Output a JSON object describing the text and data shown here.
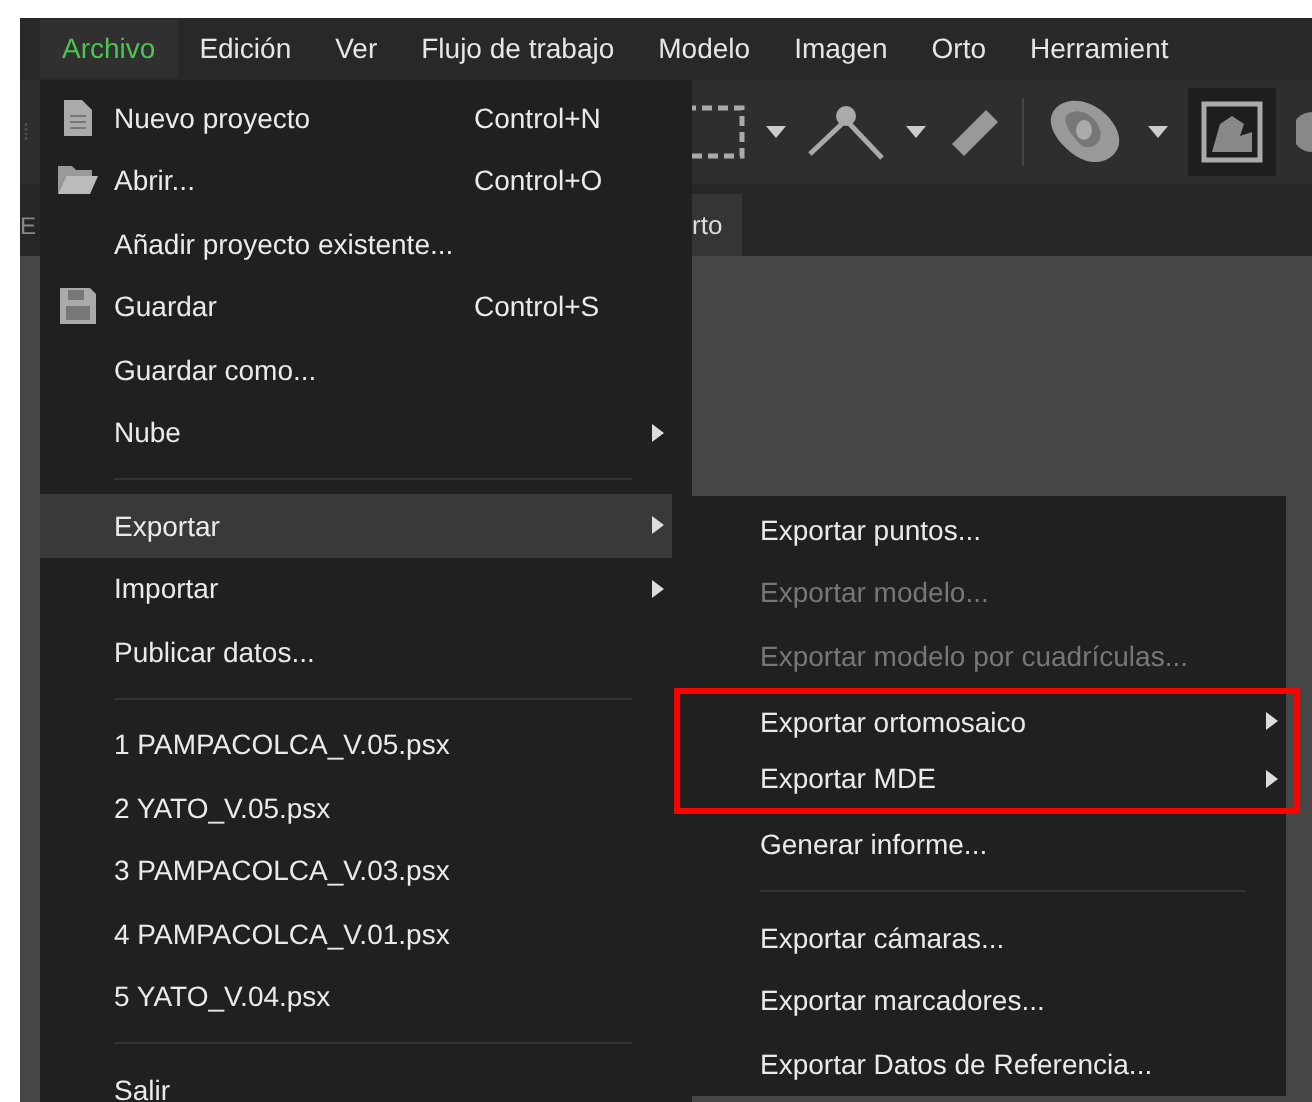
{
  "menubar": [
    {
      "label": "Archivo",
      "selected": true
    },
    {
      "label": "Edición",
      "selected": false
    },
    {
      "label": "Ver",
      "selected": false
    },
    {
      "label": "Flujo de trabajo",
      "selected": false
    },
    {
      "label": "Modelo",
      "selected": false
    },
    {
      "label": "Imagen",
      "selected": false
    },
    {
      "label": "Orto",
      "selected": false
    },
    {
      "label": "Herramient",
      "selected": false
    }
  ],
  "side_strip": {
    "label": "E"
  },
  "tabs": [
    {
      "label": "rto"
    }
  ],
  "file_menu": [
    {
      "kind": "item",
      "label": "Nuevo proyecto",
      "shortcut": "Control+N",
      "submenu": false,
      "selected": false
    },
    {
      "kind": "item",
      "label": "Abrir...",
      "shortcut": "Control+O",
      "submenu": false,
      "selected": false
    },
    {
      "kind": "item",
      "label": "Añadir proyecto existente...",
      "submenu": false,
      "selected": false
    },
    {
      "kind": "item",
      "label": "Guardar",
      "shortcut": "Control+S",
      "submenu": false,
      "selected": false
    },
    {
      "kind": "item",
      "label": "Guardar como...",
      "submenu": false,
      "selected": false
    },
    {
      "kind": "item",
      "label": "Nube",
      "submenu": true,
      "selected": false
    },
    {
      "kind": "separator"
    },
    {
      "kind": "item",
      "label": "Exportar",
      "submenu": true,
      "selected": true
    },
    {
      "kind": "item",
      "label": "Importar",
      "submenu": true,
      "selected": false
    },
    {
      "kind": "item",
      "label": "Publicar datos...",
      "submenu": false,
      "selected": false
    },
    {
      "kind": "separator"
    },
    {
      "kind": "item",
      "label": "1 PAMPACOLCA_V.05.psx",
      "submenu": false,
      "selected": false
    },
    {
      "kind": "item",
      "label": "2 YATO_V.05.psx",
      "submenu": false,
      "selected": false
    },
    {
      "kind": "item",
      "label": "3 PAMPACOLCA_V.03.psx",
      "submenu": false,
      "selected": false
    },
    {
      "kind": "item",
      "label": "4 PAMPACOLCA_V.01.psx",
      "submenu": false,
      "selected": false
    },
    {
      "kind": "item",
      "label": "5 YATO_V.04.psx",
      "submenu": false,
      "selected": false
    },
    {
      "kind": "separator"
    },
    {
      "kind": "item",
      "label": "Salir",
      "submenu": false,
      "selected": false
    }
  ],
  "export_submenu": [
    {
      "kind": "item",
      "label": "Exportar puntos...",
      "disabled": false,
      "submenu": false,
      "boxed": false
    },
    {
      "kind": "item",
      "label": "Exportar modelo...",
      "disabled": true,
      "submenu": false,
      "boxed": false
    },
    {
      "kind": "item",
      "label": "Exportar modelo por cuadrículas...",
      "disabled": true,
      "submenu": false,
      "boxed": false
    },
    {
      "kind": "item",
      "label": "Exportar ortomosaico",
      "disabled": false,
      "submenu": true,
      "boxed": true
    },
    {
      "kind": "item",
      "label": "Exportar MDE",
      "disabled": false,
      "submenu": true,
      "boxed": true
    },
    {
      "kind": "item",
      "label": "Generar informe...",
      "disabled": false,
      "submenu": false,
      "boxed": false
    },
    {
      "kind": "separator"
    },
    {
      "kind": "item",
      "label": "Exportar cámaras...",
      "disabled": false,
      "submenu": false,
      "boxed": false
    },
    {
      "kind": "item",
      "label": "Exportar marcadores...",
      "disabled": false,
      "submenu": false,
      "boxed": false
    },
    {
      "kind": "item",
      "label": "Exportar Datos de Referencia...",
      "disabled": false,
      "submenu": false,
      "boxed": false
    }
  ]
}
